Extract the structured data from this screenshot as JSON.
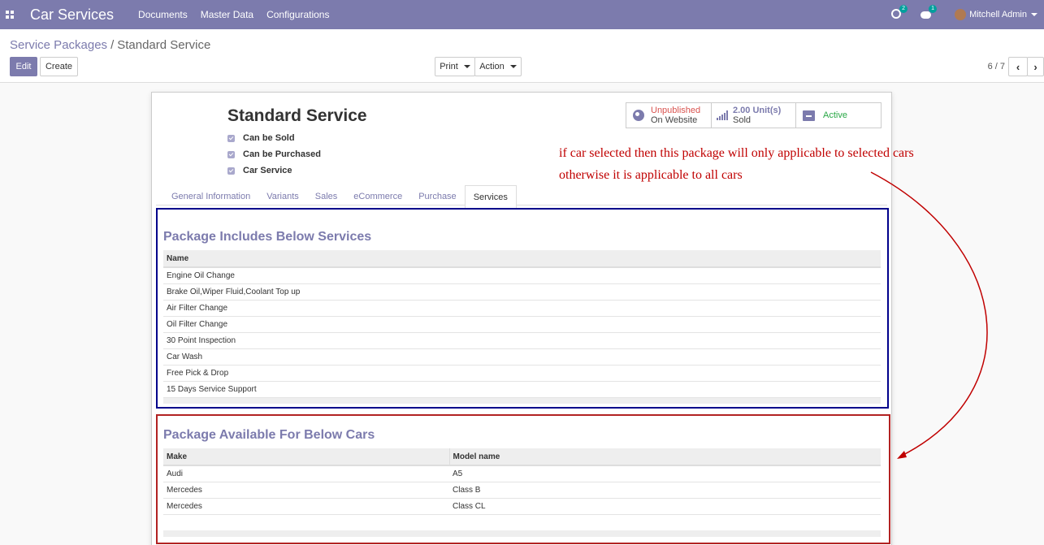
{
  "navbar": {
    "app_title": "Car Services",
    "menu": [
      "Documents",
      "Master Data",
      "Configurations"
    ],
    "activity_count": "2",
    "message_count": "1",
    "user_name": "Mitchell Admin"
  },
  "breadcrumb": {
    "parent": "Service Packages",
    "separator": "/",
    "current": "Standard Service"
  },
  "buttons": {
    "edit": "Edit",
    "create": "Create",
    "print": "Print",
    "action": "Action"
  },
  "pager": {
    "value": "6 / 7"
  },
  "product": {
    "name": "Standard Service",
    "checks": [
      {
        "label": "Can be Sold",
        "checked": true
      },
      {
        "label": "Can be Purchased",
        "checked": true
      },
      {
        "label": "Car Service",
        "checked": true
      }
    ]
  },
  "stats": {
    "website_status": "Unpublished",
    "website_label": "On Website",
    "sold_value": "2.00 Unit(s)",
    "sold_label": "Sold",
    "active_label": "Active"
  },
  "tabs": [
    "General Information",
    "Variants",
    "Sales",
    "eCommerce",
    "Purchase",
    "Services"
  ],
  "active_tab": "Services",
  "services_section": {
    "title": "Package Includes Below Services",
    "header": "Name",
    "rows": [
      "Engine Oil Change",
      "Brake Oil,Wiper Fluid,Coolant Top up",
      "Air Filter Change",
      "Oil Filter Change",
      "30 Point Inspection",
      "Car Wash",
      "Free Pick & Drop",
      "15 Days Service Support"
    ]
  },
  "cars_section": {
    "title": "Package Available For Below Cars",
    "headers": [
      "Make",
      "Model name"
    ],
    "rows": [
      {
        "make": "Audi",
        "model": "A5"
      },
      {
        "make": "Mercedes",
        "model": "Class B"
      },
      {
        "make": "Mercedes",
        "model": "Class CL"
      }
    ]
  },
  "annotation": {
    "line1": "if car selected then this package will only applicable to selected cars",
    "line2": "otherwise it is applicable to all cars"
  },
  "colors": {
    "brand": "#7c7bad",
    "annotation": "#c00000",
    "services_border": "#00008b",
    "cars_border": "#b22222",
    "unpublished": "#d9534f",
    "active": "#28a745"
  }
}
